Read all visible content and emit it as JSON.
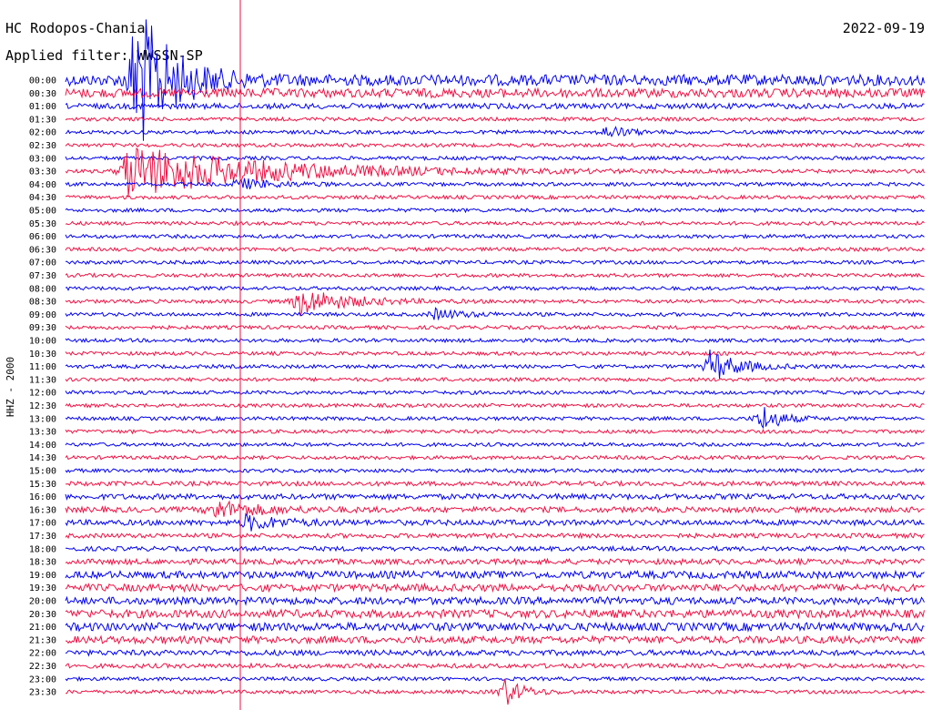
{
  "chart_data": {
    "type": "line",
    "title": "HC Rodopos-Chania",
    "date": "2022-09-19",
    "filter": "Applied filter: WWSSN-SP",
    "ylabel": "HHZ - 2000",
    "row_labels": [
      "00:00",
      "00:30",
      "01:00",
      "01:30",
      "02:00",
      "02:30",
      "03:00",
      "03:30",
      "04:00",
      "04:30",
      "05:00",
      "05:30",
      "06:00",
      "06:30",
      "07:00",
      "07:30",
      "08:00",
      "08:30",
      "09:00",
      "09:30",
      "10:00",
      "10:30",
      "11:00",
      "11:30",
      "12:00",
      "12:30",
      "13:00",
      "13:30",
      "14:00",
      "14:30",
      "15:00",
      "15:30",
      "16:00",
      "16:30",
      "17:00",
      "17:30",
      "18:00",
      "18:30",
      "19:00",
      "19:30",
      "20:00",
      "20:30",
      "21:00",
      "21:30",
      "22:00",
      "22:30",
      "23:00",
      "23:30"
    ],
    "colors": [
      "#0000ee",
      "#ee1144"
    ],
    "row_noise": [
      6,
      5,
      3,
      2,
      2,
      2,
      2,
      2,
      2,
      2,
      2,
      2,
      2,
      2,
      2,
      2,
      2,
      2,
      2,
      2,
      2,
      2,
      2,
      2,
      2,
      2,
      2,
      2,
      2,
      2,
      2,
      2.5,
      3,
      3,
      3,
      2.5,
      2.5,
      3,
      4,
      4,
      4,
      4.5,
      4.5,
      4,
      3,
      2.5,
      2,
      2
    ],
    "events": [
      {
        "row": 0,
        "x": 0.08,
        "amp": 90,
        "width": 0.04
      },
      {
        "row": 7,
        "x": 0.07,
        "amp": 30,
        "width": 0.15
      },
      {
        "row": 4,
        "x": 0.63,
        "amp": 8,
        "width": 0.02
      },
      {
        "row": 8,
        "x": 0.2,
        "amp": 6,
        "width": 0.04
      },
      {
        "row": 17,
        "x": 0.27,
        "amp": 16,
        "width": 0.05
      },
      {
        "row": 18,
        "x": 0.43,
        "amp": 6,
        "width": 0.03
      },
      {
        "row": 22,
        "x": 0.75,
        "amp": 18,
        "width": 0.03
      },
      {
        "row": 26,
        "x": 0.81,
        "amp": 16,
        "width": 0.02
      },
      {
        "row": 33,
        "x": 0.17,
        "amp": 10,
        "width": 0.05
      },
      {
        "row": 34,
        "x": 0.21,
        "amp": 8,
        "width": 0.04
      },
      {
        "row": 47,
        "x": 0.51,
        "amp": 16,
        "width": 0.02
      }
    ]
  }
}
